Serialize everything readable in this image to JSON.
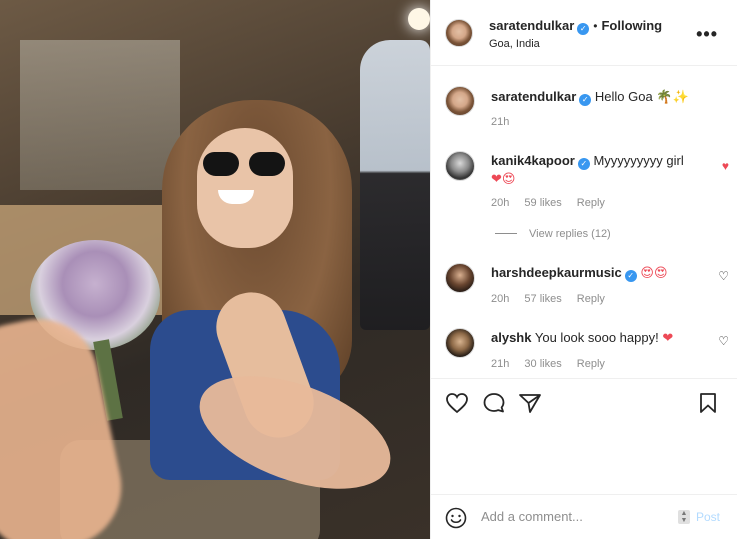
{
  "post": {
    "author": "saratendulkar",
    "follow_status": "Following",
    "separator": "•",
    "location": "Goa, India",
    "more_icon": "•••"
  },
  "caption": {
    "username": "saratendulkar",
    "text": "Hello Goa",
    "emoji": "🌴✨",
    "time": "21h"
  },
  "comments": [
    {
      "username": "kanik4kapoor",
      "text": "Myyyyyyyyy girl",
      "emoji": "❤😍",
      "time": "20h",
      "likes": "59 likes",
      "reply": "Reply",
      "liked": true
    },
    {
      "username": "harshdeepkaurmusic",
      "text": "",
      "emoji": "😍😍",
      "time": "20h",
      "likes": "57 likes",
      "reply": "Reply",
      "liked": false
    },
    {
      "username": "alyshk",
      "text": "You look sooo happy!",
      "emoji": "❤",
      "time": "21h",
      "likes": "30 likes",
      "reply": "Reply",
      "liked": false
    }
  ],
  "view_replies": "View replies (12)",
  "add_comment": {
    "placeholder": "Add a comment...",
    "post_label": "Post"
  }
}
